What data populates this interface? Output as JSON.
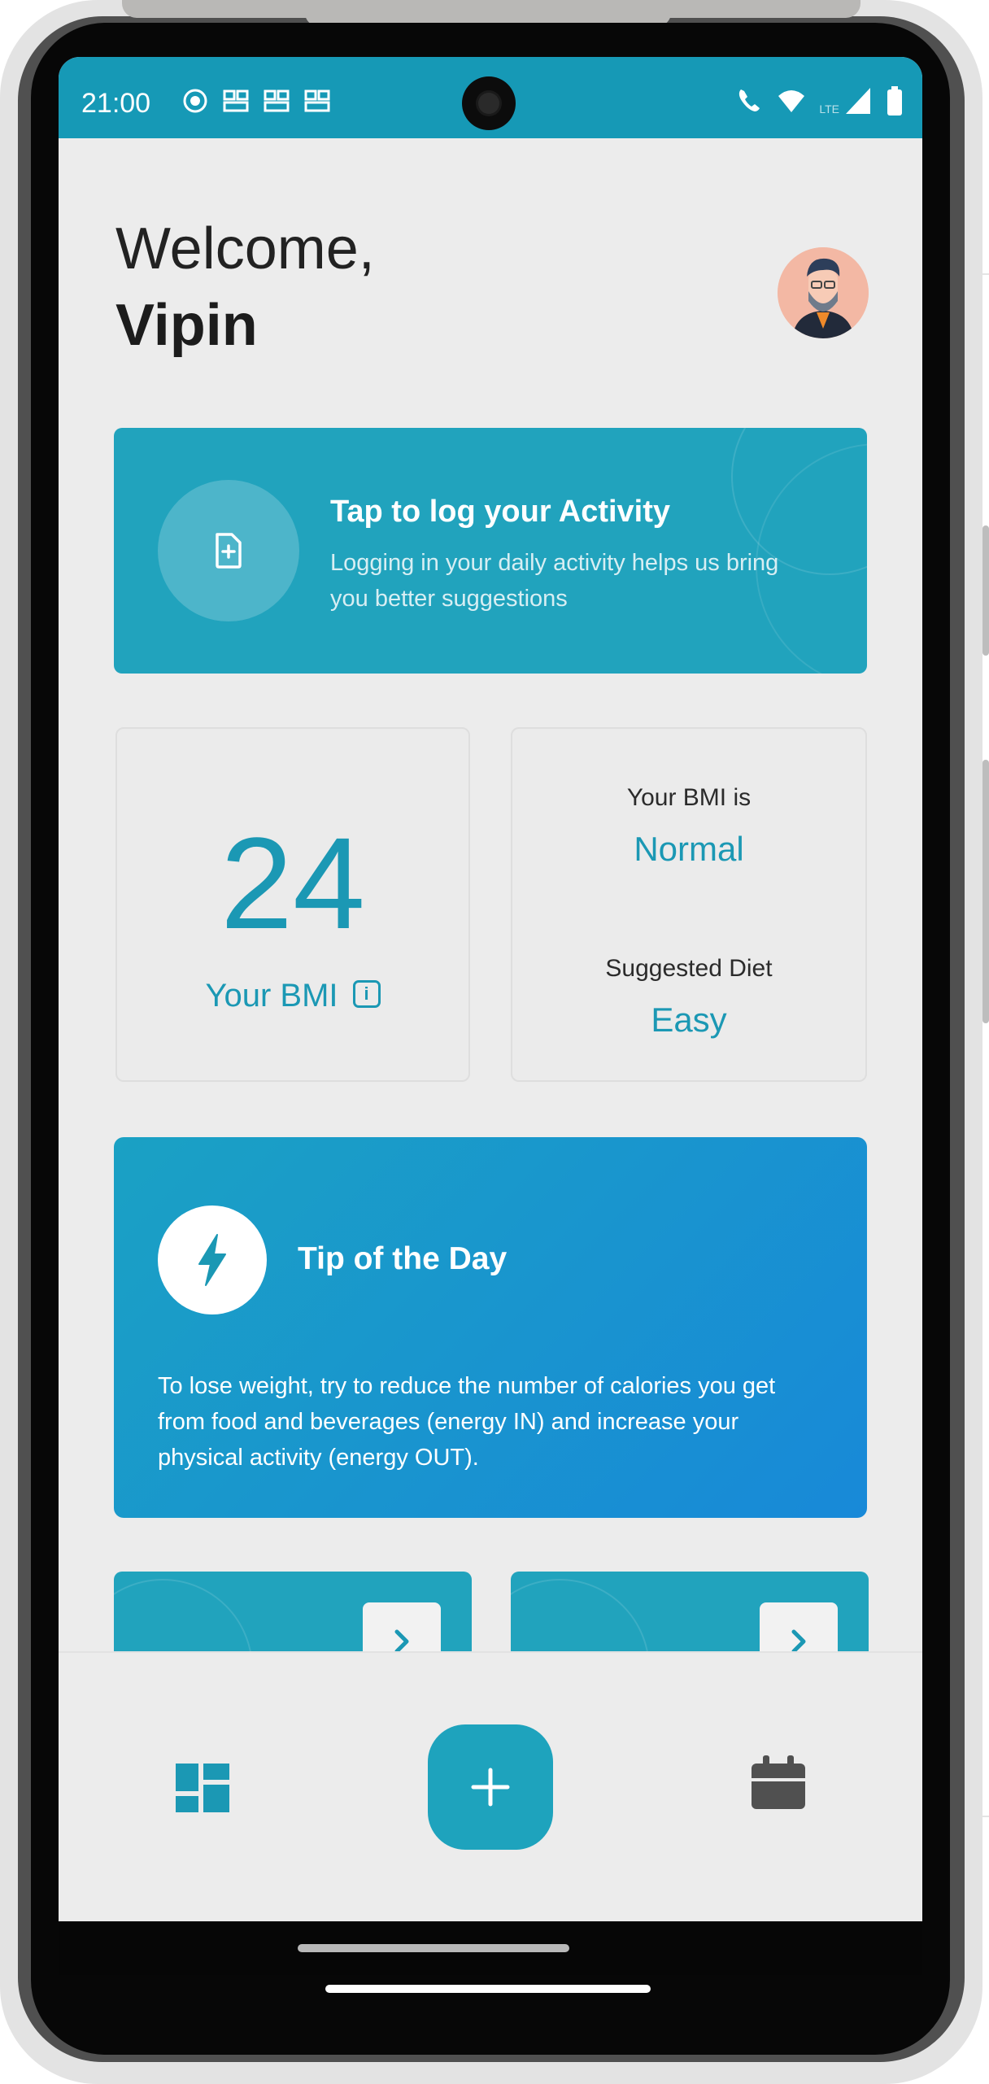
{
  "status_bar": {
    "time": "21:00",
    "left_icons": [
      "record-icon",
      "notification-icon",
      "notification-icon",
      "notification-icon"
    ],
    "right_icons": [
      "wifi-calling-icon",
      "wifi-icon",
      "lte-signal-icon",
      "battery-icon"
    ],
    "network_label": "LTE"
  },
  "header": {
    "greeting": "Welcome,",
    "username": "Vipin"
  },
  "activity_card": {
    "title": "Tap to log your Activity",
    "description": "Logging in your daily activity helps us bring you better suggestions"
  },
  "bmi_card": {
    "value": "24",
    "label": "Your BMI",
    "info_icon": "info-icon"
  },
  "status_card": {
    "bmi_caption": "Your BMI is",
    "bmi_status": "Normal",
    "diet_caption": "Suggested Diet",
    "diet_value": "Easy"
  },
  "tip_card": {
    "title": "Tip of the Day",
    "text": "To lose weight, try to reduce the number of calories you get from food and beverages (energy IN) and increase your physical activity (energy OUT)."
  },
  "bottom_nav": {
    "items": [
      "dashboard-icon",
      "add-icon",
      "calendar-icon"
    ]
  },
  "colors": {
    "accent": "#1ea3bd",
    "status_bar": "#1699b6",
    "tip_gradient_end": "#1889d8",
    "background": "#ececec"
  }
}
